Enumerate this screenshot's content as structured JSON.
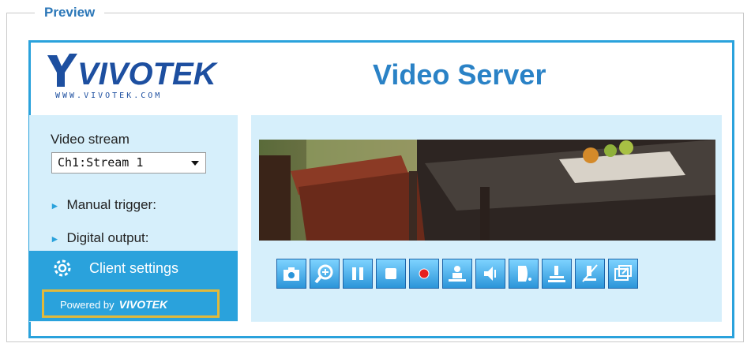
{
  "preview": {
    "legend": "Preview"
  },
  "header": {
    "logo_text": "VIVOTEK",
    "logo_url": "WWW.VIVOTEK.COM",
    "title": "Video Server"
  },
  "sidebar": {
    "video_stream_label": "Video stream",
    "video_stream_value": "Ch1:Stream 1",
    "items": [
      {
        "label": "Manual trigger:"
      },
      {
        "label": "Digital output:"
      }
    ],
    "client_settings_label": "Client settings",
    "powered_by_label": "Powered by",
    "powered_by_brand": "VIVOTEK"
  },
  "toolbar": {
    "buttons": [
      {
        "icon": "camera-icon"
      },
      {
        "icon": "zoom-in-icon"
      },
      {
        "icon": "pause-icon"
      },
      {
        "icon": "stop-icon"
      },
      {
        "icon": "record-icon"
      },
      {
        "icon": "talk-icon"
      },
      {
        "icon": "speaker-mute-icon"
      },
      {
        "icon": "volume-icon"
      },
      {
        "icon": "mic-icon"
      },
      {
        "icon": "mic-mute-icon"
      },
      {
        "icon": "fullscreen-icon"
      }
    ]
  },
  "colors": {
    "accent": "#2aa2dc",
    "panel_bg": "#d6effb",
    "title_blue": "#2a82c6",
    "logo_blue": "#1d4fa0",
    "highlight": "#e1b93a"
  }
}
